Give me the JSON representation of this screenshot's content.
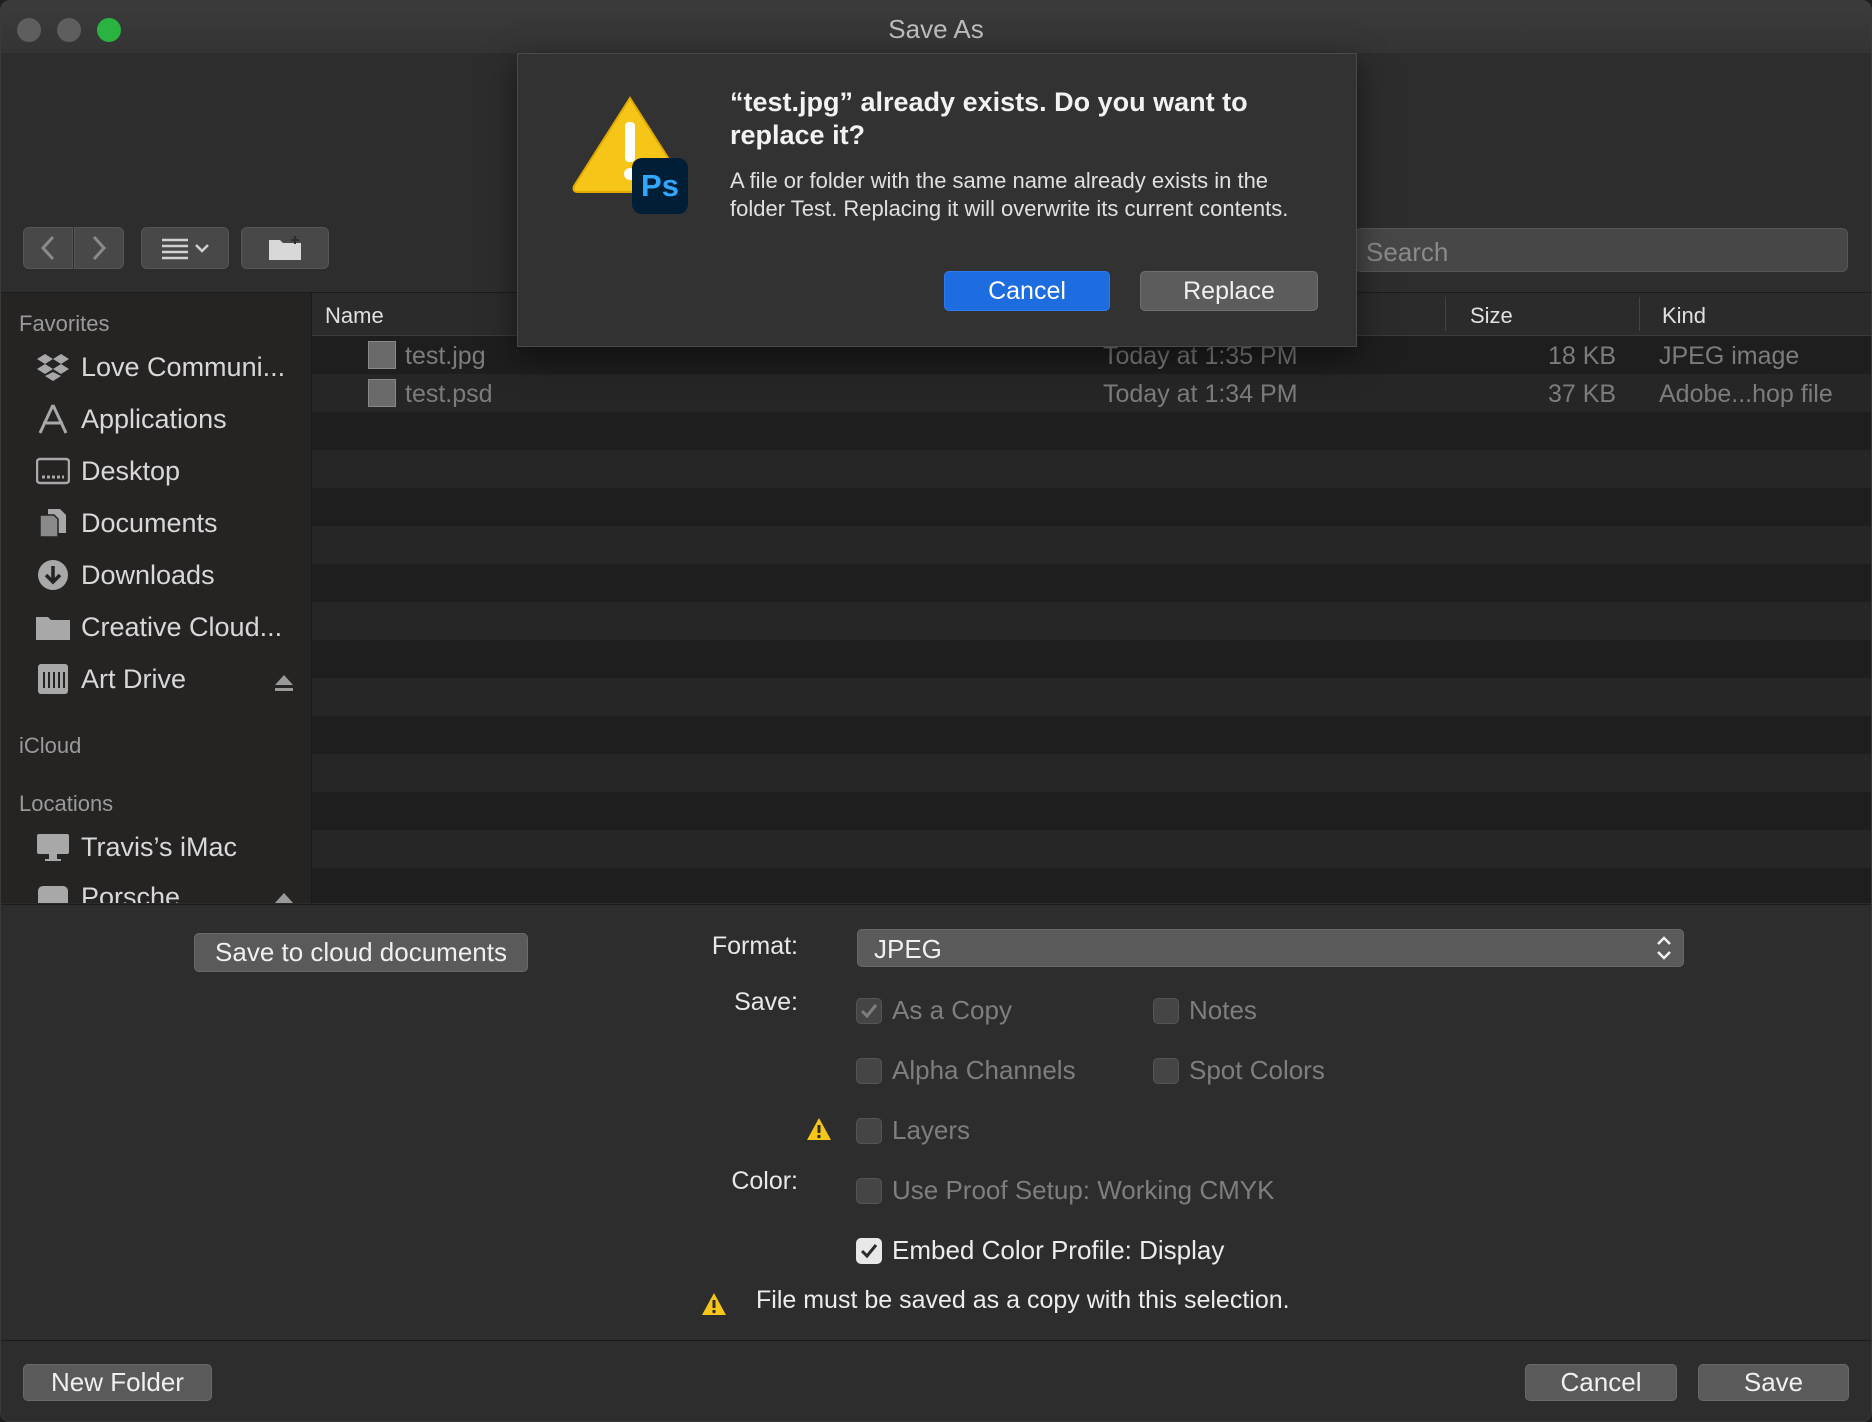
{
  "window": {
    "title": "Save As"
  },
  "toolbar": {
    "search_placeholder": "Search"
  },
  "sidebar": {
    "favorites_header": "Favorites",
    "favorites": [
      {
        "label": "Love Communi...",
        "icon": "dropbox-icon"
      },
      {
        "label": "Applications",
        "icon": "applications-icon"
      },
      {
        "label": "Desktop",
        "icon": "desktop-icon"
      },
      {
        "label": "Documents",
        "icon": "documents-icon"
      },
      {
        "label": "Downloads",
        "icon": "downloads-icon"
      },
      {
        "label": "Creative Cloud...",
        "icon": "folder-icon"
      },
      {
        "label": "Art Drive",
        "icon": "drive-icon"
      }
    ],
    "icloud_header": "iCloud",
    "locations_header": "Locations",
    "locations": [
      {
        "label": "Travis’s iMac",
        "icon": "computer-icon"
      },
      {
        "label": "Porsche",
        "icon": "drive-icon"
      }
    ]
  },
  "filelist": {
    "columns": {
      "name": "Name",
      "size": "Size",
      "kind": "Kind"
    },
    "rows": [
      {
        "name": "test.jpg",
        "date": "Today at 1:35 PM",
        "size": "18 KB",
        "kind": "JPEG image"
      },
      {
        "name": "test.psd",
        "date": "Today at 1:34 PM",
        "size": "37 KB",
        "kind": "Adobe...hop file"
      }
    ]
  },
  "options": {
    "cloud_button": "Save to cloud documents",
    "format_label": "Format:",
    "format_value": "JPEG",
    "save_label": "Save:",
    "as_copy": "As a Copy",
    "notes": "Notes",
    "alpha_channels": "Alpha Channels",
    "spot_colors": "Spot Colors",
    "layers": "Layers",
    "color_label": "Color:",
    "use_proof": "Use Proof Setup:  Working CMYK",
    "embed_profile": "Embed Color Profile:  Display",
    "warning": "File must be saved as a copy with this selection."
  },
  "footer": {
    "new_folder": "New Folder",
    "cancel": "Cancel",
    "save": "Save"
  },
  "dialog": {
    "title": "“test.jpg” already exists. Do you want to replace it?",
    "message": "A file or folder with the same name already exists in the folder Test. Replacing it will overwrite its current contents.",
    "cancel": "Cancel",
    "replace": "Replace",
    "app_badge": "Ps"
  },
  "colors": {
    "accent": "#1d6ce0",
    "warning": "#f5c518",
    "ps_blue": "#31a8ff"
  }
}
